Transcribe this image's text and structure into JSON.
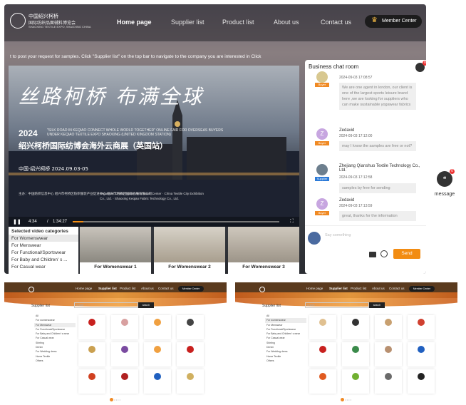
{
  "nav": {
    "logo_line1": "中国绍兴柯桥",
    "logo_line2": "国际纺织品面辅料博览会",
    "logo_line3": "SHAOXING TEXTILE EXPO, SHAOXING CHINA",
    "links": [
      "Home page",
      "Supplier list",
      "Product list",
      "About us",
      "Contact us"
    ],
    "member": "Member Center"
  },
  "ticker": "t to post your request for samples.     Click \"Supplier list\" on the top bar to navigate to the company you are interested in     Click",
  "video": {
    "calligraphy": "丝路柯桥 布满全球",
    "year": "2024",
    "sub1": "\"SILK ROAD IN KEQIAO CONNECT WHOLE WORLD TOGETHER\" ONLINE FAIR FOR OVERSEAS BUYERS UNDER KEQIAO TEXTILE EXPO SHAOXING (UNITED KINGDOM STATION)",
    "title": "绍兴柯桥国际纺博会海外云商展（英国站）",
    "date": "中国·绍兴柯桥    2024.09.03-05",
    "organizer_cn": "主办：中国纺织信息中心 绍兴市柯桥区纺织服装产业促进中心 绍兴市柯桥区国际会展有限公司",
    "organizer_en": "Organiser: China Textile Information Center · China Textile City Exhibition Co., Ltd. · Shaoxing Keqiao Fabric Technology Co., Ltd.",
    "time_current": "4:34",
    "time_sep": "/",
    "time_total": "1:34:27",
    "progress": 0.05
  },
  "categories": {
    "header": "Selected video categories",
    "items": [
      "For Womenswear",
      "For Menswear",
      "For Functional/Sportswear",
      "For Baby and Children' s ...",
      "For Casual wear"
    ],
    "selected": 0
  },
  "thumbs": [
    "For Womenswear 1",
    "For Womenswear 2",
    "For Womenswear 3"
  ],
  "chat": {
    "title": "Business chat room",
    "unread": "0",
    "messages": [
      {
        "initial": "",
        "role": "Buyer",
        "name": "",
        "time": "2024-09-03 17:08:57",
        "text": "We are one agent in london, our client is one of the largest sports leisure brand here ,we are looking for suppliers who can make sustainable yogawear fabrics"
      },
      {
        "initial": "Z",
        "role": "Buyer",
        "name": "Zedavid",
        "time": "2024-09-03 17:12:00",
        "text": "may I know the samples are free or not?"
      },
      {
        "initial": "",
        "role": "Supplier",
        "name": "Zhejiang Qianshuo Textile Technology Co., Ltd.",
        "time": "2024-09-03 17:12:58",
        "text": "samples by free for sending"
      },
      {
        "initial": "Z",
        "role": "Buyer",
        "name": "Zedavid",
        "time": "2024-09-03 17:13:59",
        "text": "great, thanks for the information"
      }
    ],
    "input_placeholder": "Say something",
    "send": "Send"
  },
  "float_button": {
    "label": "message",
    "unread": "0"
  },
  "supplier_panels": [
    {
      "nav": [
        "Home page",
        "Supplier list",
        "Product list",
        "About us",
        "Contact us"
      ],
      "member": "Member Center",
      "list_title": "Supplier list",
      "search_placeholder": "search",
      "search_btn": "search",
      "cats": [
        "All",
        "For womenswear",
        "For Menswear",
        "For Functional/Sportswear",
        "For Baby and Children' s wear",
        "For Casual wear",
        "Shirting",
        "Denim",
        "For Wedding dress",
        "Home Textile",
        "Others"
      ],
      "selected": 2
    },
    {
      "nav": [
        "Home page",
        "Supplier list",
        "Product list",
        "About us",
        "Contact us"
      ],
      "member": "Member Center",
      "list_title": "Supplier list",
      "search_placeholder": "search",
      "search_btn": "search",
      "cats": [
        "All",
        "For womenswear",
        "For Menswear",
        "For Functional/Sportswear",
        "For Baby and Children' s wear",
        "For Casual wear",
        "Shirting",
        "Denim",
        "For Wedding dress",
        "Home Textile",
        "Others"
      ],
      "selected": 1
    }
  ],
  "colors": {
    "accent": "#f28c12",
    "buyer": "#f08a24",
    "supplier": "#2d7bd8",
    "panel_header": "#5a3a1e"
  }
}
